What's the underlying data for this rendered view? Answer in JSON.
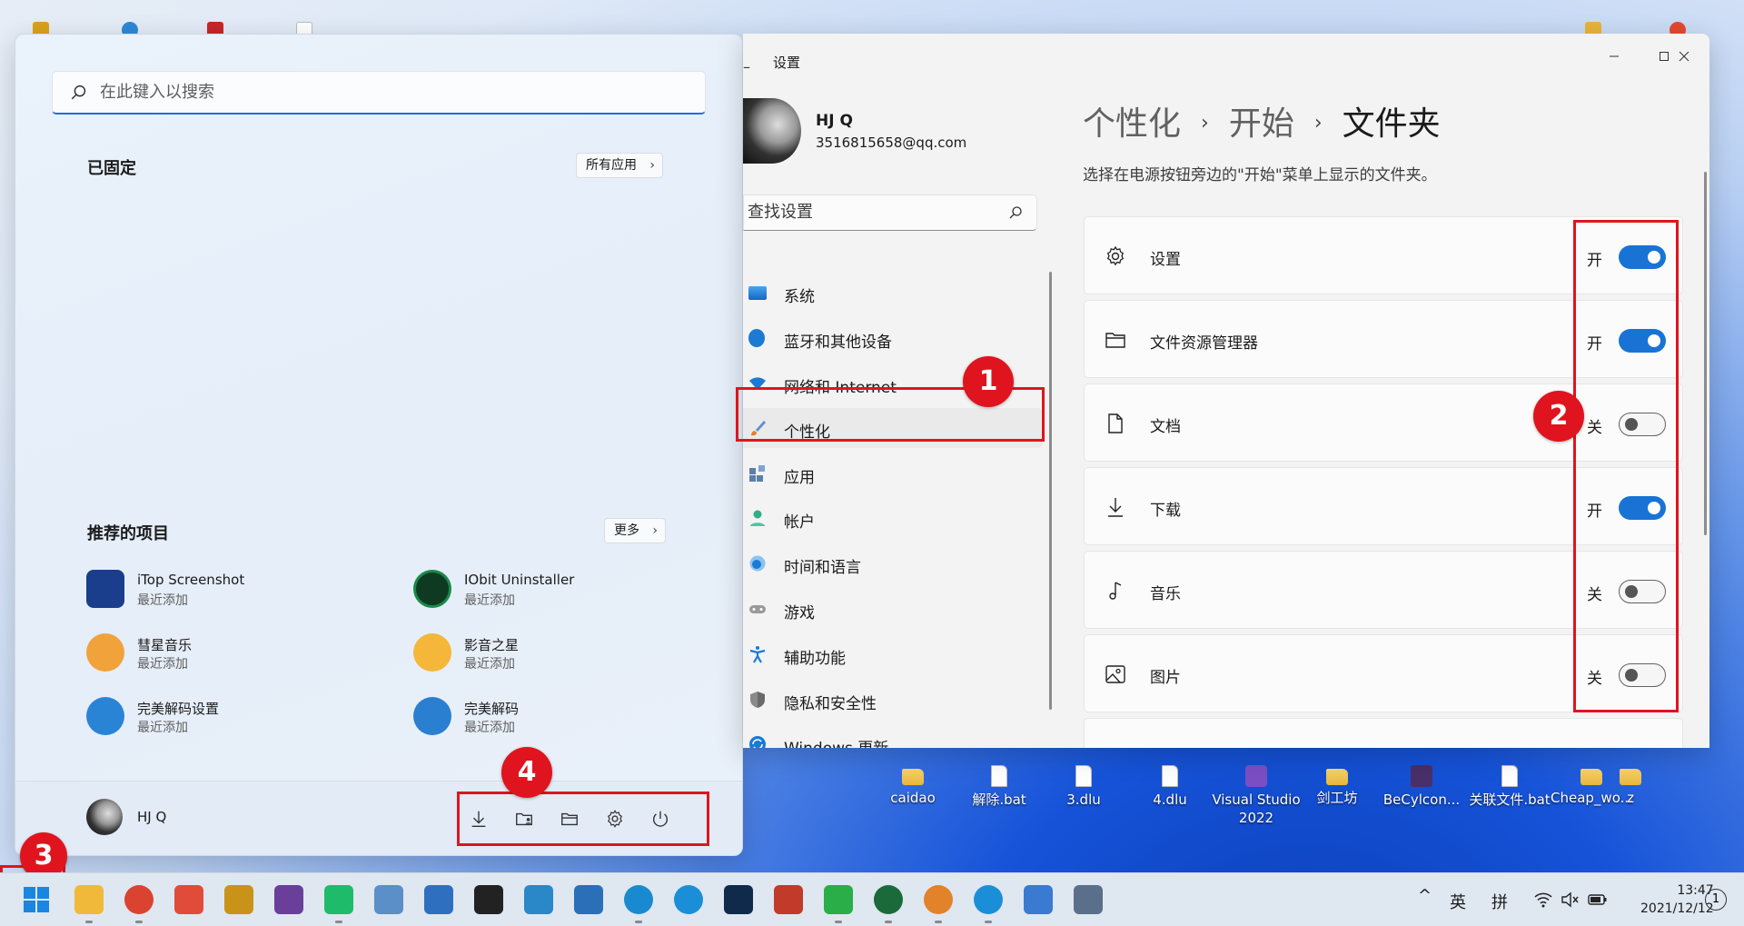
{
  "start_menu": {
    "search_placeholder": "在此键入以搜索",
    "pinned_title": "已固定",
    "all_apps_label": "所有应用",
    "recommended_title": "推荐的项目",
    "more_label": "更多",
    "recommended": [
      {
        "name": "iTop Screenshot",
        "sub": "最近添加",
        "icon": "itop-screenshot-icon",
        "color": "#1b3e8c"
      },
      {
        "name": "IObit Uninstaller",
        "sub": "最近添加",
        "icon": "iobit-uninstaller-icon",
        "color": "#1a8a4a"
      },
      {
        "name": "彗星音乐",
        "sub": "最近添加",
        "icon": "comet-music-icon",
        "color": "#f2a23a"
      },
      {
        "name": "影音之星",
        "sub": "最近添加",
        "icon": "media-star-icon",
        "color": "#f4b73a"
      },
      {
        "name": "完美解码设置",
        "sub": "最近添加",
        "icon": "potplayer-settings-icon",
        "color": "#2a84d6"
      },
      {
        "name": "完美解码",
        "sub": "最近添加",
        "icon": "potplayer-icon",
        "color": "#2a7fd0"
      }
    ],
    "user_name": "HJ Q"
  },
  "settings": {
    "window_title": "设置",
    "user_name": "HJ Q",
    "user_email": "3516815658@qq.com",
    "find_placeholder": "查找设置",
    "nav": [
      {
        "label": "系统",
        "icon": "system-icon",
        "color": "#1a7ad4"
      },
      {
        "label": "蓝牙和其他设备",
        "icon": "bluetooth-icon",
        "color": "#1a7ad4"
      },
      {
        "label": "网络和 Internet",
        "icon": "wifi-icon",
        "color": "#1a7ad4"
      },
      {
        "label": "个性化",
        "icon": "brush-icon",
        "color": "#e87d2e"
      },
      {
        "label": "应用",
        "icon": "apps-icon",
        "color": "#5b7fa8"
      },
      {
        "label": "帐户",
        "icon": "account-icon",
        "color": "#2fae8a"
      },
      {
        "label": "时间和语言",
        "icon": "clock-globe-icon",
        "color": "#1a7ad4"
      },
      {
        "label": "游戏",
        "icon": "gamepad-icon",
        "color": "#8a8a8a"
      },
      {
        "label": "辅助功能",
        "icon": "accessibility-icon",
        "color": "#1a7ad4"
      },
      {
        "label": "隐私和安全性",
        "icon": "shield-icon",
        "color": "#6e6e6e"
      },
      {
        "label": "Windows 更新",
        "icon": "update-icon",
        "color": "#1a7ad4"
      }
    ],
    "breadcrumb": [
      "个性化",
      "开始",
      "文件夹"
    ],
    "description": "选择在电源按钮旁边的\"开始\"菜单上显示的文件夹。",
    "rows": [
      {
        "label": "设置",
        "state": "开",
        "on": true,
        "icon": "gear-icon"
      },
      {
        "label": "文件资源管理器",
        "state": "开",
        "on": true,
        "icon": "folder-icon"
      },
      {
        "label": "文档",
        "state": "关",
        "on": false,
        "icon": "document-icon"
      },
      {
        "label": "下载",
        "state": "开",
        "on": true,
        "icon": "download-icon"
      },
      {
        "label": "音乐",
        "state": "关",
        "on": false,
        "icon": "music-icon"
      },
      {
        "label": "图片",
        "state": "关",
        "on": false,
        "icon": "picture-icon"
      }
    ]
  },
  "annotations": [
    "1",
    "2",
    "3",
    "4"
  ],
  "desktop_items": [
    "caidao",
    "解除.bat",
    "3.dlu",
    "4.dlu",
    "Visual Studio 2022",
    "剑工坊",
    "BeCylcon...",
    "关联文件.bat",
    "Cheap_wo...",
    "z"
  ],
  "taskbar": {
    "apps": [
      {
        "icon": "file-explorer-icon",
        "color": "#f0b93a"
      },
      {
        "icon": "chrome-icon",
        "color": "#d9432f"
      },
      {
        "icon": "colorful-app-icon",
        "color": "#e14b3a"
      },
      {
        "icon": "rh-app-icon",
        "color": "#c9931a"
      },
      {
        "icon": "screenshot-tool-icon",
        "color": "#6a3f9a"
      },
      {
        "icon": "pycharm-icon",
        "color": "#1dbb6a"
      },
      {
        "icon": "chart-app-icon",
        "color": "#5a8fc8"
      },
      {
        "icon": "network-app-icon",
        "color": "#2f6fc0"
      },
      {
        "icon": "qq-icon",
        "color": "#222222"
      },
      {
        "icon": "virtual-box-icon",
        "color": "#2a87c8"
      },
      {
        "icon": "blocks-app-icon",
        "color": "#2a6fb8"
      },
      {
        "icon": "edge-icon",
        "color": "#1a8ad0"
      },
      {
        "icon": "feather-app-icon",
        "color": "#1a8fd8"
      },
      {
        "icon": "photoshop-icon",
        "color": "#0f2a4a"
      },
      {
        "icon": "bug-app-icon",
        "color": "#c23a2a"
      },
      {
        "icon": "wechat-icon",
        "color": "#2aae47"
      },
      {
        "icon": "uninstaller-icon",
        "color": "#1a6a3a"
      },
      {
        "icon": "shell-app-icon",
        "color": "#e2822a"
      },
      {
        "icon": "feather-app-2-icon",
        "color": "#1a8fd8"
      },
      {
        "icon": "notepad-icon",
        "color": "#3a7ad0"
      },
      {
        "icon": "settings-gear-icon",
        "color": "#5a6f8a"
      }
    ],
    "ime_lang": "英",
    "ime_mode": "拼",
    "time": "13:47",
    "date": "2021/12/12",
    "notifications": "1"
  },
  "colors": {
    "accent": "#1873d5",
    "annotation_red": "#e0141e"
  }
}
